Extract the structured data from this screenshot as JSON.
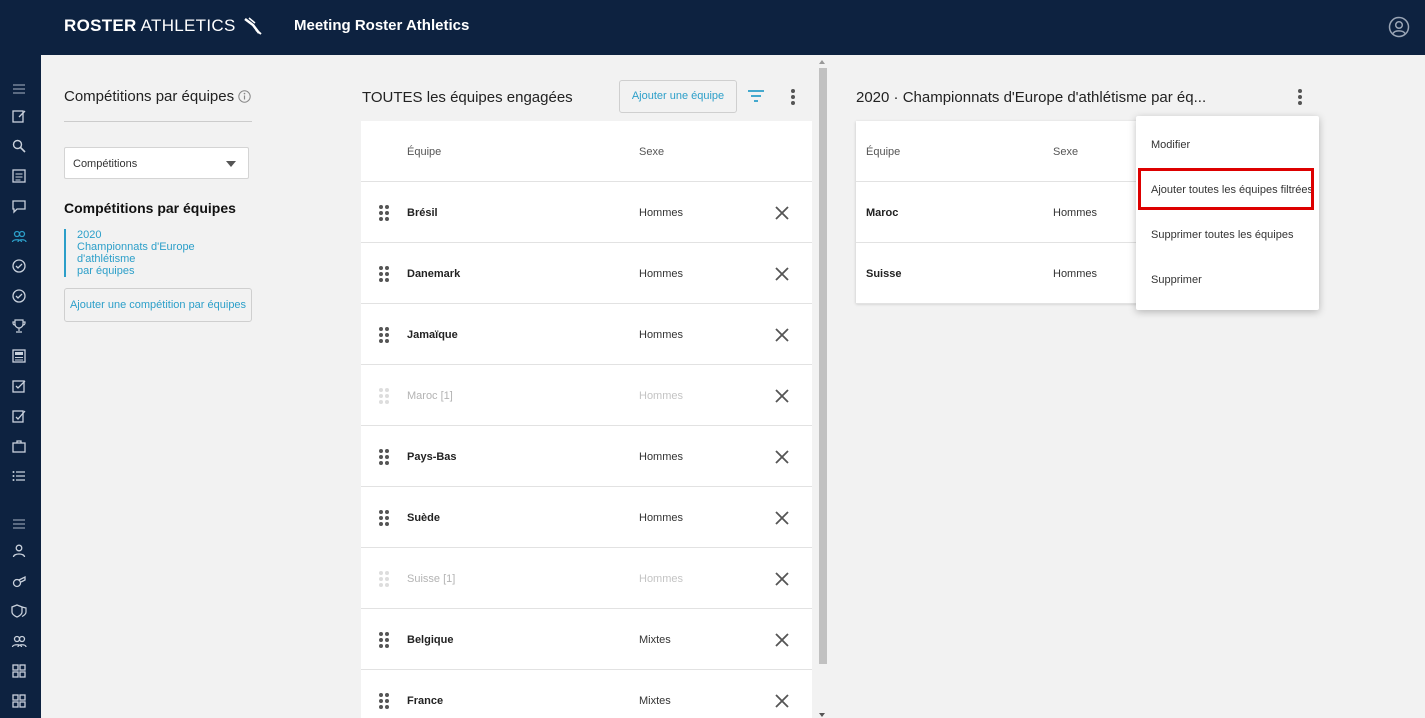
{
  "header": {
    "brand_bold": "ROSTER",
    "brand_light": "ATHLETICS",
    "app_title": "Meeting Roster Athletics"
  },
  "left_panel": {
    "title": "Compétitions par équipes",
    "select_value": "Compétitions",
    "section_heading": "Compétitions par équipes",
    "competition_year": "2020",
    "competition_name_line1": "Championnats d'Europe d'athlétisme",
    "competition_name_line2": "par équipes",
    "add_button": "Ajouter une compétition par équipes"
  },
  "middle_panel": {
    "title": "TOUTES les équipes engagées",
    "add_button": "Ajouter une équipe",
    "columns": [
      "Équipe",
      "Sexe"
    ],
    "rows": [
      {
        "name": "Brésil",
        "sex": "Hommes",
        "dimmed": false
      },
      {
        "name": "Danemark",
        "sex": "Hommes",
        "dimmed": false
      },
      {
        "name": "Jamaïque",
        "sex": "Hommes",
        "dimmed": false
      },
      {
        "name": "Maroc [1]",
        "sex": "Hommes",
        "dimmed": true
      },
      {
        "name": "Pays-Bas",
        "sex": "Hommes",
        "dimmed": false
      },
      {
        "name": "Suède",
        "sex": "Hommes",
        "dimmed": false
      },
      {
        "name": "Suisse [1]",
        "sex": "Hommes",
        "dimmed": true
      },
      {
        "name": "Belgique",
        "sex": "Mixtes",
        "dimmed": false
      },
      {
        "name": "France",
        "sex": "Mixtes",
        "dimmed": false
      }
    ]
  },
  "right_panel": {
    "title": "2020 · Championnats d'Europe d'athlétisme par éq...",
    "columns": [
      "Équipe",
      "Sexe"
    ],
    "rows": [
      {
        "name": "Maroc",
        "sex": "Hommes"
      },
      {
        "name": "Suisse",
        "sex": "Hommes"
      }
    ]
  },
  "context_menu": {
    "items": [
      "Modifier",
      "Ajouter toutes les équipes filtrées",
      "Supprimer toutes les équipes",
      "Supprimer"
    ],
    "highlighted_index": 1
  },
  "colors": {
    "navy": "#0d2240",
    "accent": "#2c9fc9",
    "highlight": "#dd0000"
  },
  "icons": {
    "rail": [
      "menu-icon",
      "edit-icon",
      "search-icon",
      "list-icon",
      "message-icon",
      "teams-icon",
      "check-circle-icon",
      "check-circle-icon",
      "trophy-icon",
      "news-icon",
      "checkbox-icon",
      "edit-check-icon",
      "briefcase-icon",
      "bullet-list-icon",
      "menu-icon",
      "person-icon",
      "whistle-icon",
      "shield-icon",
      "group-icon",
      "grid-icon",
      "grid-icon"
    ]
  }
}
